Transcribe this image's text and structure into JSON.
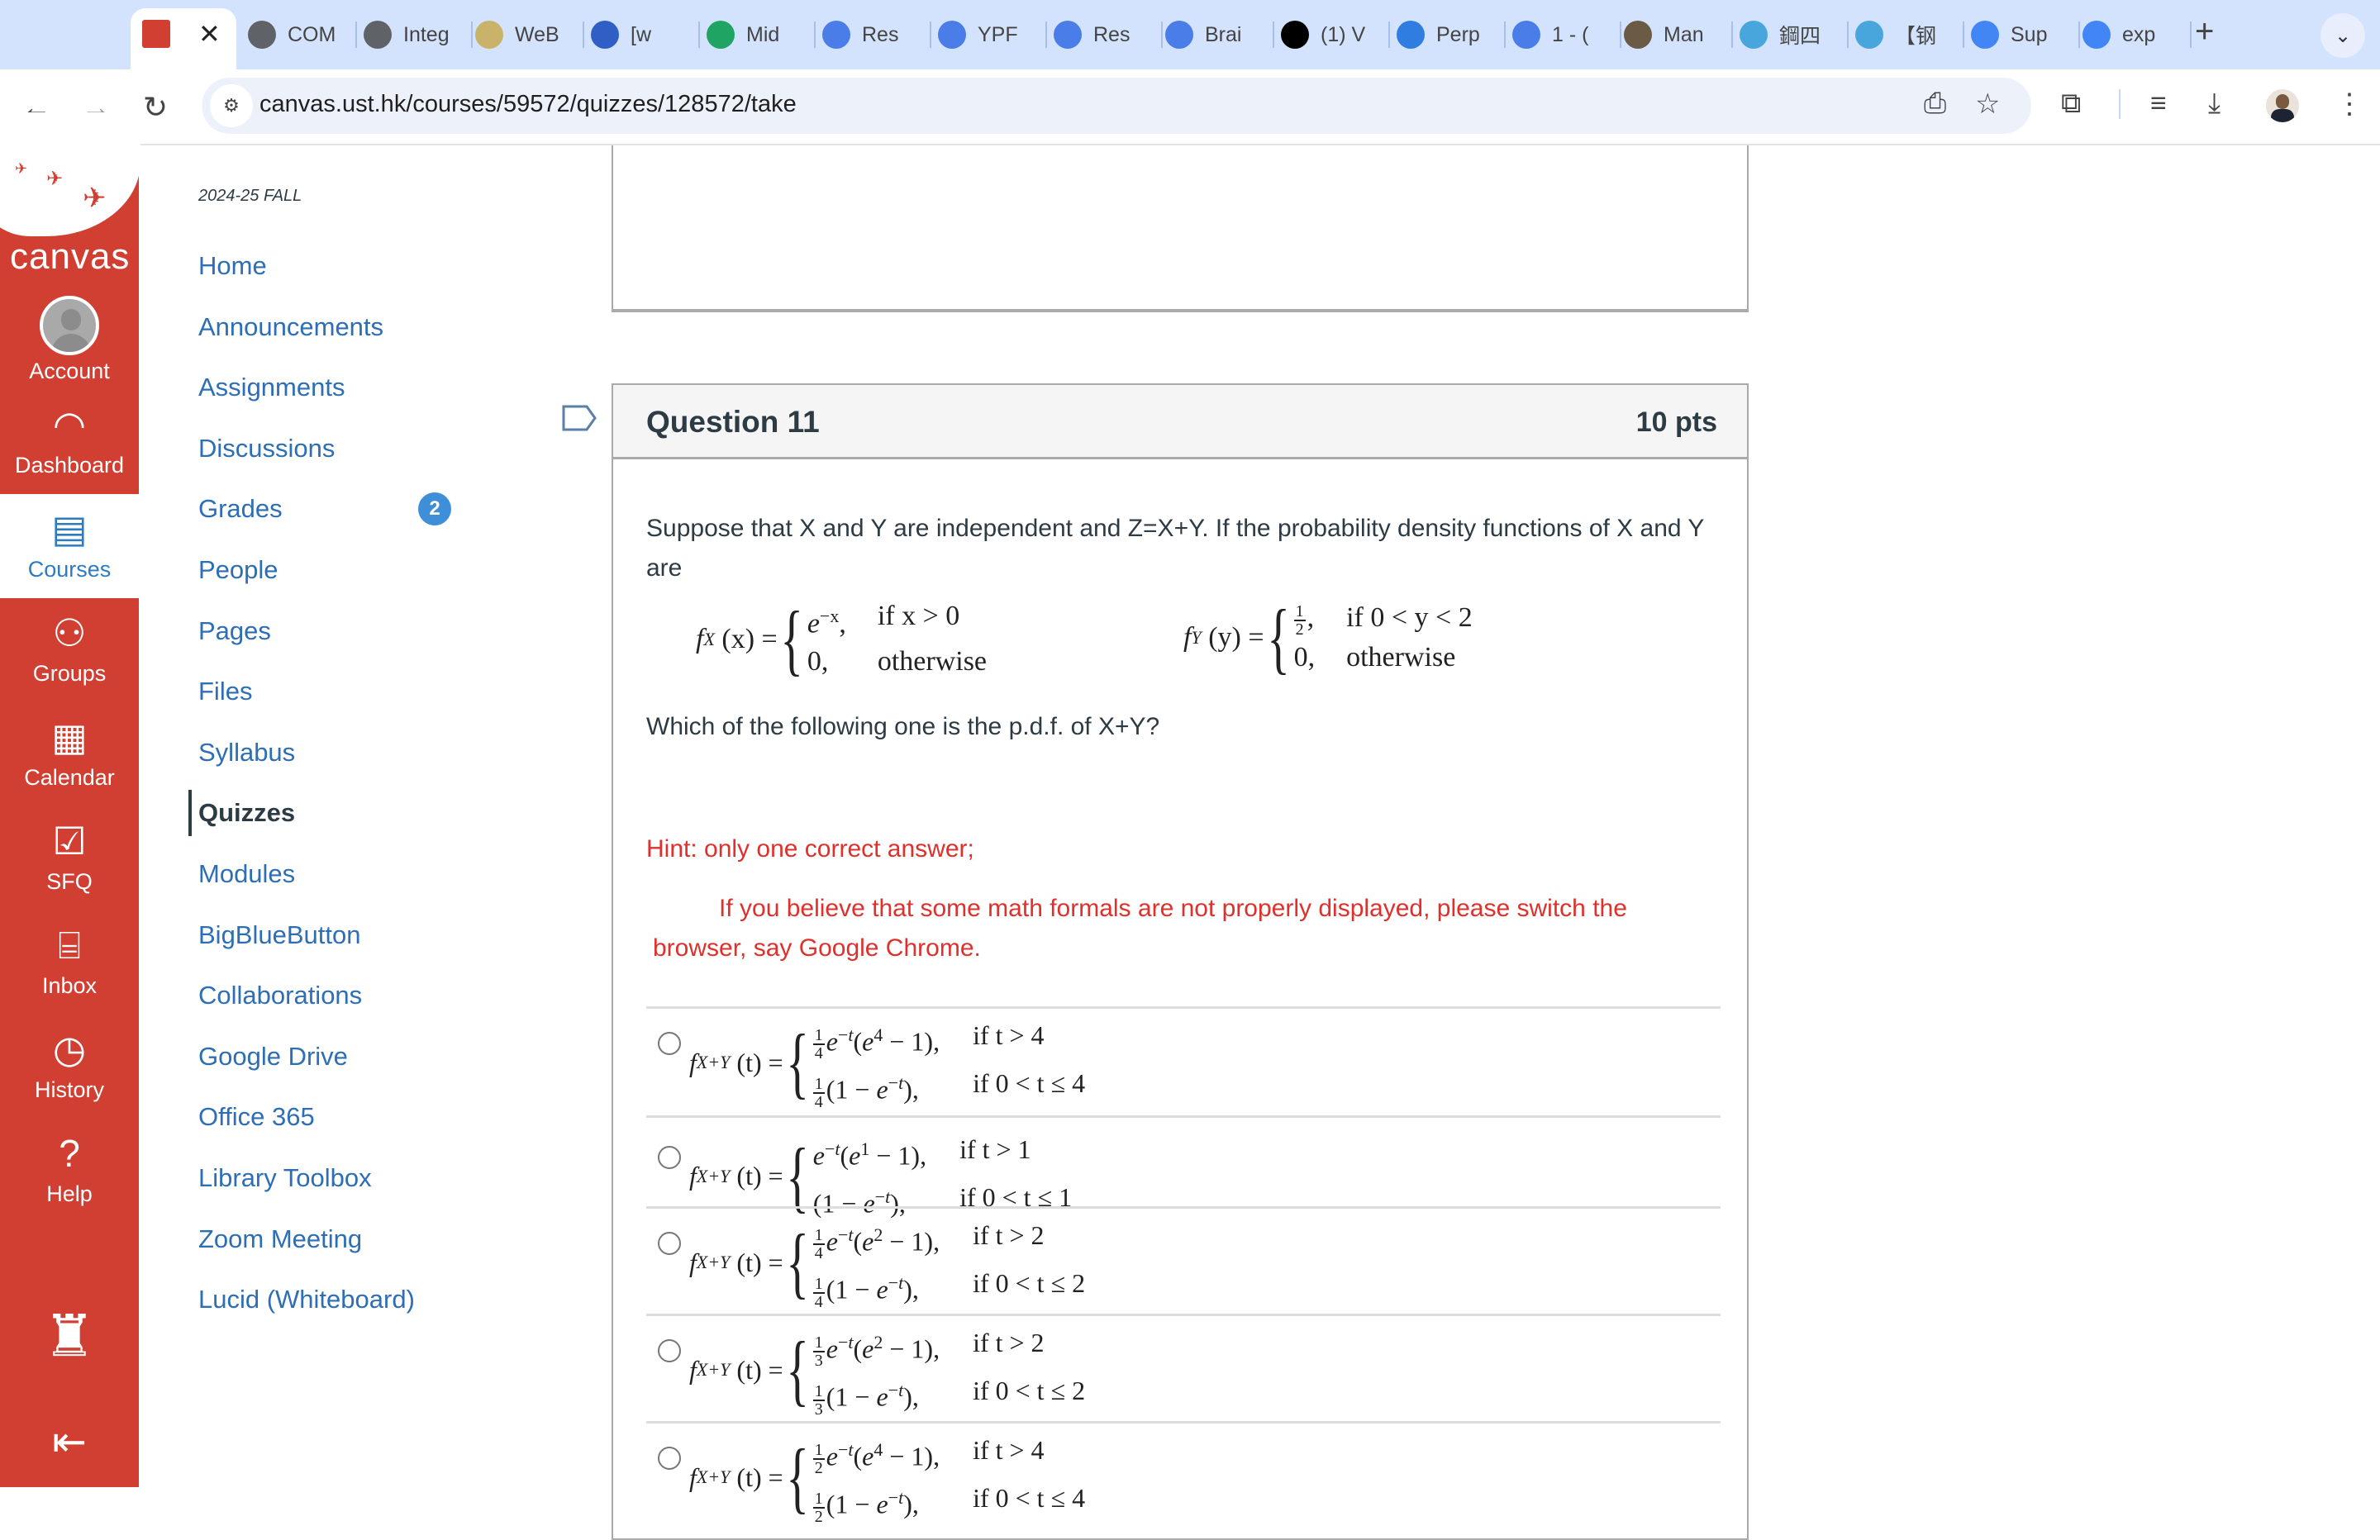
{
  "browser": {
    "active_tab": {
      "close_label": "✕"
    },
    "tabs": [
      {
        "label": "COM",
        "icon": "globe-icon",
        "color": "#5f6368"
      },
      {
        "label": "Integ",
        "icon": "globe-icon",
        "color": "#5f6368"
      },
      {
        "label": "WeB",
        "icon": "spiderweb-icon",
        "color": "#c9b36b"
      },
      {
        "label": "[w",
        "icon": "chat-bubble-icon",
        "color": "#2f5fc5"
      },
      {
        "label": "Mid",
        "icon": "google-drive-icon",
        "color": "#1fa463"
      },
      {
        "label": "Res",
        "icon": "doc-lines-icon",
        "color": "#4a7de8"
      },
      {
        "label": "YPF",
        "icon": "doc-lines-icon",
        "color": "#4a7de8"
      },
      {
        "label": "Res",
        "icon": "docs-icon",
        "color": "#4a7de8"
      },
      {
        "label": "Brai",
        "icon": "docs-icon",
        "color": "#4a7de8"
      },
      {
        "label": "(1) V",
        "icon": "black-logo-icon",
        "color": "#000000"
      },
      {
        "label": "Perp",
        "icon": "app-store-icon",
        "color": "#2f7de1"
      },
      {
        "label": "1 - (",
        "icon": "doc-lines-icon",
        "color": "#4a7de8"
      },
      {
        "label": "Man",
        "icon": "photo-thumbnail-icon",
        "color": "#6b5a44"
      },
      {
        "label": "鋼四",
        "icon": "bilibili-icon",
        "color": "#49a6dc"
      },
      {
        "label": "【钢",
        "icon": "bilibili-icon",
        "color": "#49a6dc"
      },
      {
        "label": "Sup",
        "icon": "google-icon",
        "color": "#4285f4"
      },
      {
        "label": "exp",
        "icon": "google-icon",
        "color": "#4285f4"
      }
    ],
    "new_tab_label": "+",
    "url": "canvas.ust.hk/courses/59572/quizzes/128572/take"
  },
  "global_nav": {
    "logo_text": "canvas",
    "items": [
      {
        "label": "Account",
        "icon": "account-avatar-icon"
      },
      {
        "label": "Dashboard",
        "icon": "dashboard-gauge-icon"
      },
      {
        "label": "Courses",
        "icon": "courses-book-icon",
        "active": true
      },
      {
        "label": "Groups",
        "icon": "groups-icon"
      },
      {
        "label": "Calendar",
        "icon": "calendar-icon"
      },
      {
        "label": "SFQ",
        "icon": "checkbox-icon"
      },
      {
        "label": "Inbox",
        "icon": "inbox-icon"
      },
      {
        "label": "History",
        "icon": "clock-icon"
      },
      {
        "label": "Help",
        "icon": "help-icon"
      }
    ]
  },
  "course_nav": {
    "term": "2024-25 FALL",
    "items": [
      {
        "label": "Home"
      },
      {
        "label": "Announcements"
      },
      {
        "label": "Assignments"
      },
      {
        "label": "Discussions"
      },
      {
        "label": "Grades",
        "badge": "2"
      },
      {
        "label": "People"
      },
      {
        "label": "Pages"
      },
      {
        "label": "Files"
      },
      {
        "label": "Syllabus"
      },
      {
        "label": "Quizzes",
        "active": true
      },
      {
        "label": "Modules"
      },
      {
        "label": "BigBlueButton"
      },
      {
        "label": "Collaborations"
      },
      {
        "label": "Google Drive"
      },
      {
        "label": "Office 365"
      },
      {
        "label": "Library Toolbox"
      },
      {
        "label": "Zoom Meeting"
      },
      {
        "label": "Lucid (Whiteboard)"
      }
    ]
  },
  "question": {
    "title": "Question 11",
    "points": "10 pts",
    "intro": "Suppose that X and Y are independent and Z=X+Y. If the probability density functions of X and Y are",
    "fx": {
      "lhs": "f",
      "sub": "X",
      "arg": "(x) =",
      "row1_expr": "e",
      "row1_sup": "−x",
      "row1_cond": "if x > 0",
      "row2_expr": "0,",
      "row2_cond": "otherwise"
    },
    "fy": {
      "lhs": "f",
      "sub": "Y",
      "arg": "(y) =",
      "row1_num": "1",
      "row1_den": "2",
      "row1_cond": "if 0 < y < 2",
      "row2_expr": "0,",
      "row2_cond": "otherwise"
    },
    "prompt": "Which of the following one is the p.d.f. of X+Y?",
    "hint": "Hint: only one correct answer;",
    "notice": "If you believe that some math formals are not properly displayed, please switch the browser, say Google Chrome.",
    "options": [
      {
        "coef_num": "1",
        "coef_den": "4",
        "k": "4",
        "cond1": "if t > 4",
        "cond2": "if 0 < t ≤ 4",
        "selected": false
      },
      {
        "coef_num": "",
        "coef_den": "",
        "k": "1",
        "cond1": "if t > 1",
        "cond2": "if 0 < t ≤ 1",
        "selected": false
      },
      {
        "coef_num": "1",
        "coef_den": "4",
        "k": "2",
        "cond1": "if t > 2",
        "cond2": "if 0 < t ≤ 2",
        "selected": false
      },
      {
        "coef_num": "1",
        "coef_den": "3",
        "k": "2",
        "cond1": "if t > 2",
        "cond2": "if 0 < t ≤ 2",
        "selected": false
      },
      {
        "coef_num": "1",
        "coef_den": "2",
        "k": "4",
        "cond1": "if t > 4",
        "cond2": "if 0 < t ≤ 4",
        "selected": false
      }
    ],
    "option_lhs": {
      "f": "f",
      "sub": "X+Y",
      "arg": "(t) ="
    }
  },
  "colors": {
    "canvas_red": "#d13f33",
    "link_blue": "#2d6eb5",
    "hint_red": "#e0302c",
    "badge_blue": "#3e8fd8"
  }
}
